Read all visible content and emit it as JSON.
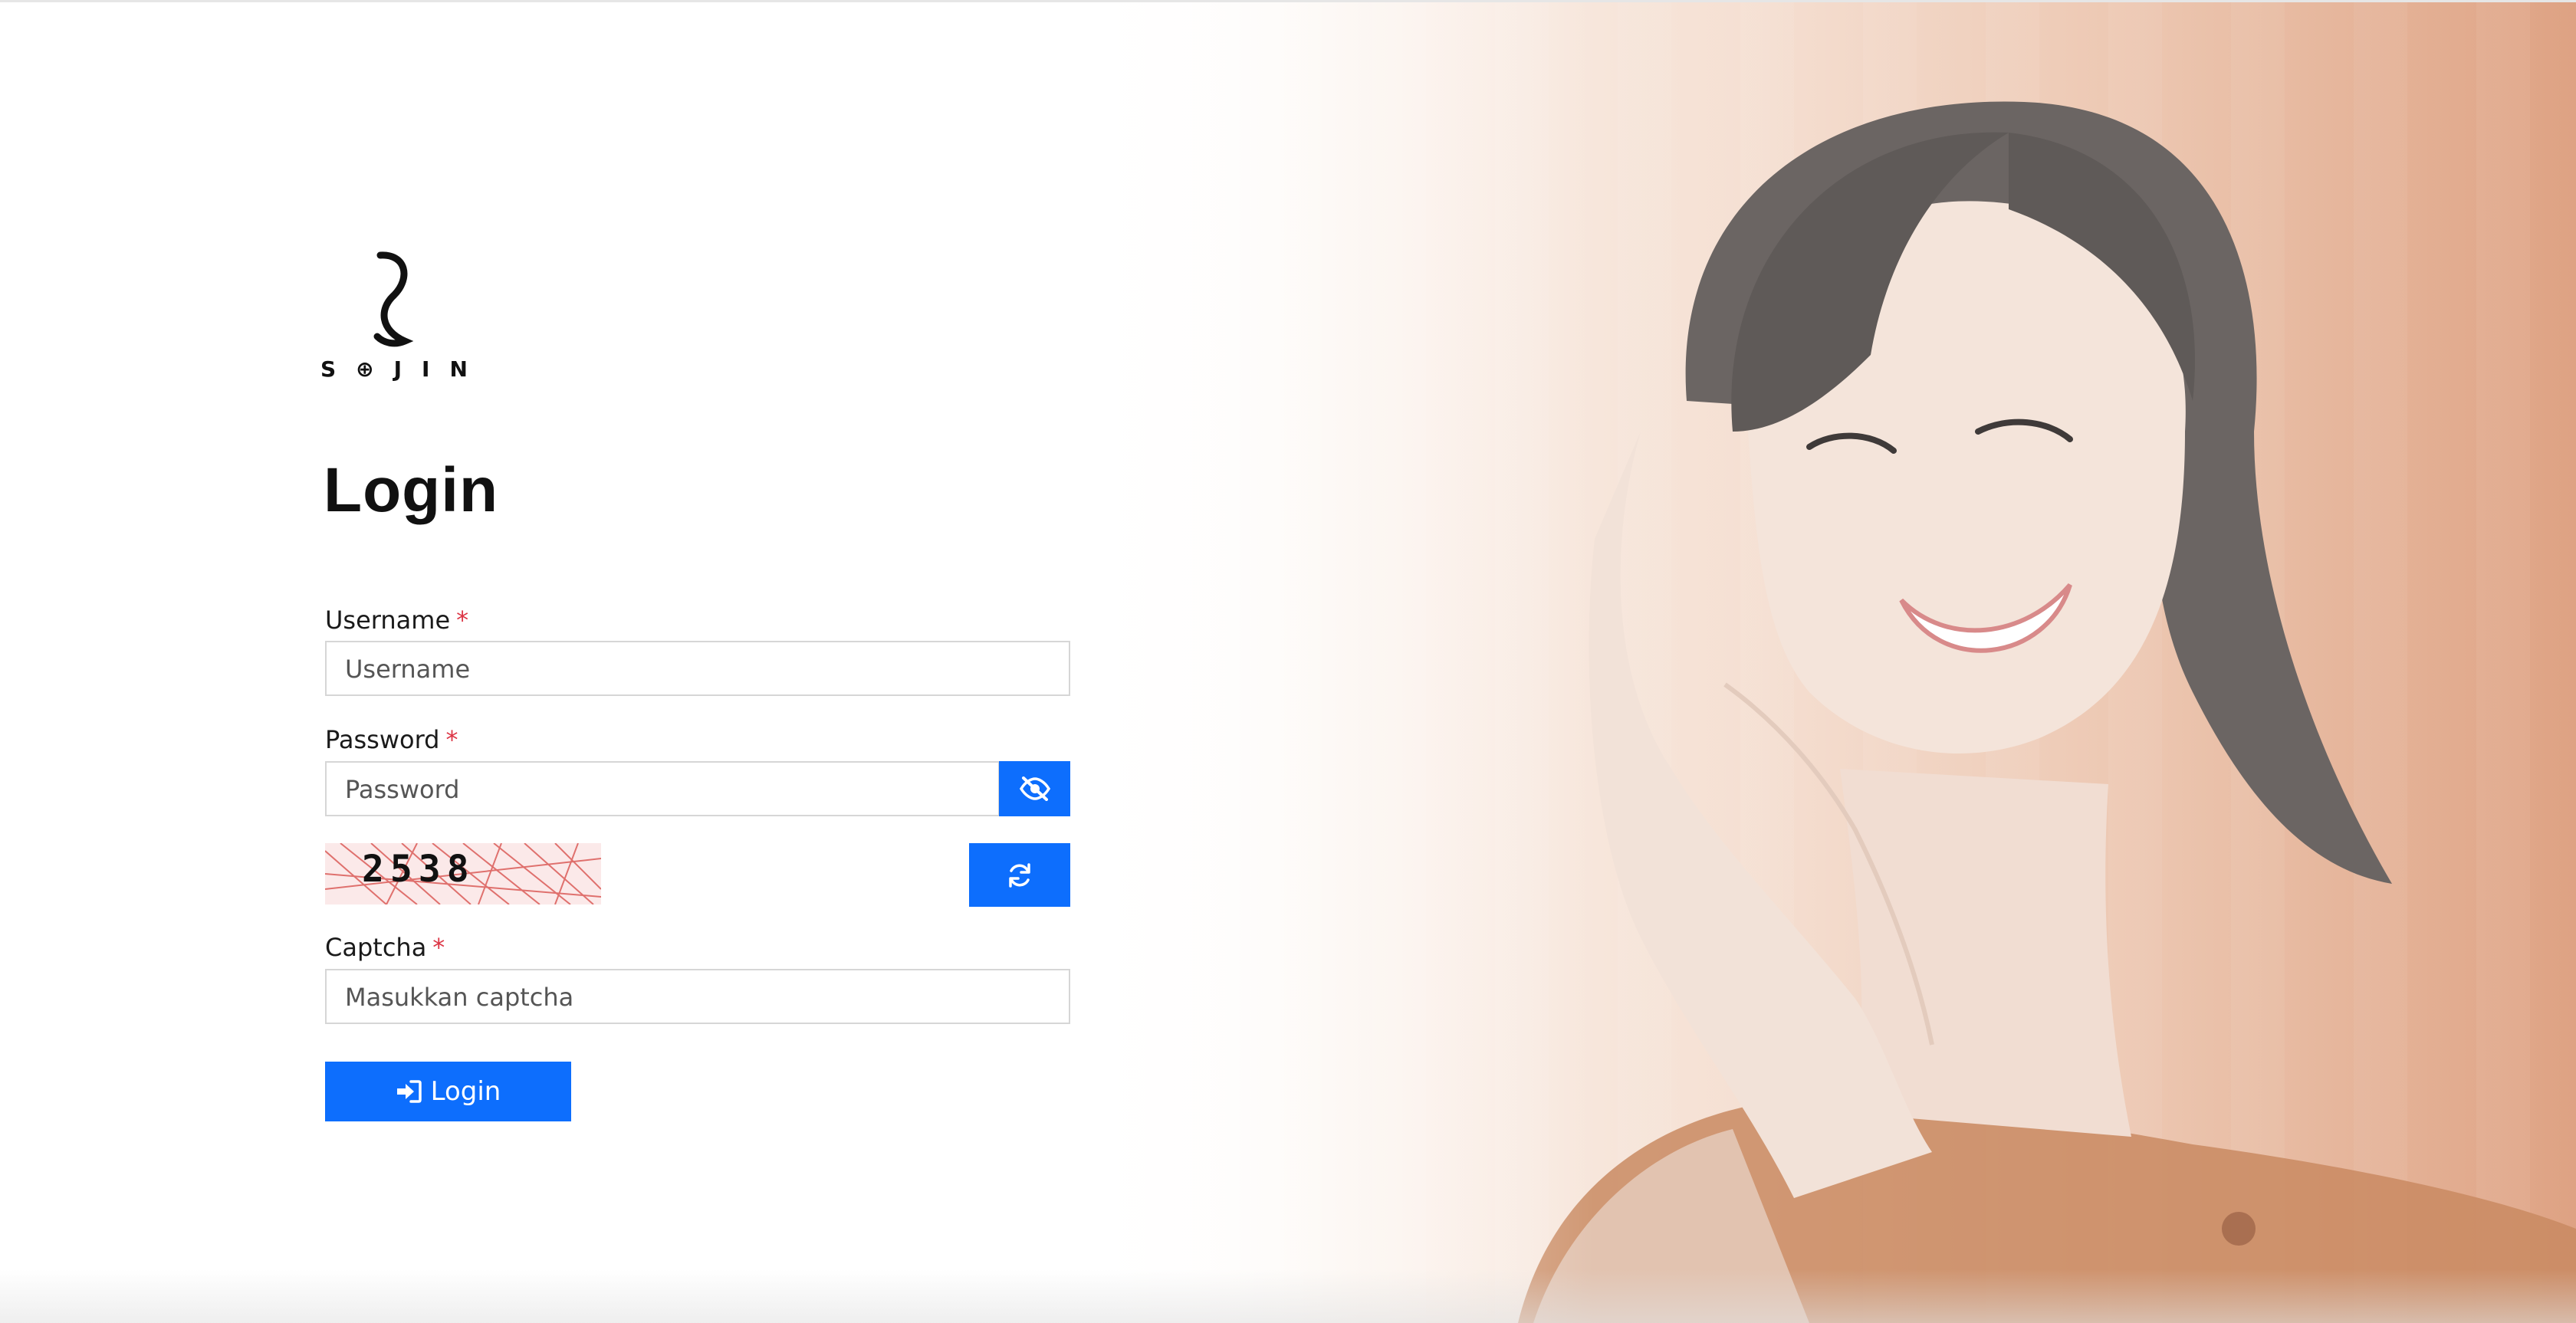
{
  "brand": {
    "logo_text": "S⊕JIN",
    "accent_color": "#0d6efd",
    "required_color": "#dc3545"
  },
  "page": {
    "title": "Login"
  },
  "form": {
    "username": {
      "label": "Username",
      "required_mark": "*",
      "placeholder": "Username",
      "value": ""
    },
    "password": {
      "label": "Password",
      "required_mark": "*",
      "placeholder": "Password",
      "value": "",
      "toggle_icon": "eye-slash-icon"
    },
    "captcha": {
      "image_code": "2538",
      "refresh_icon": "refresh-icon",
      "label": "Captcha",
      "required_mark": "*",
      "placeholder": "Masukkan captcha",
      "value": ""
    },
    "submit": {
      "label": "Login",
      "icon": "sign-in-icon"
    }
  },
  "hero": {
    "image": "smiling-woman-portrait"
  }
}
